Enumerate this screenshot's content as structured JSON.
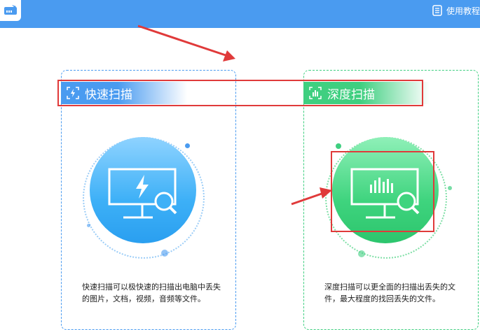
{
  "header": {
    "help_label": "使用教程",
    "logo_icon": "drive-icon",
    "help_icon": "document-icon"
  },
  "quick_scan": {
    "title": "快速扫描",
    "icon": "lightning-scan-icon",
    "illustration": "monitor-lightning-magnifier-icon",
    "description": "快速扫描可以极快速的扫描出电脑中丢失的图片，文档，视频，音频等文件。",
    "accent": "#4a9bf0"
  },
  "deep_scan": {
    "title": "深度扫描",
    "icon": "bar-chart-scan-icon",
    "illustration": "monitor-barchart-magnifier-icon",
    "description": "深度扫描可以更全面的扫描出丢失的文件，最大程度的找回丢失的文件。",
    "accent": "#3fcf80"
  },
  "annotations": {
    "color": "#e03a3a"
  }
}
